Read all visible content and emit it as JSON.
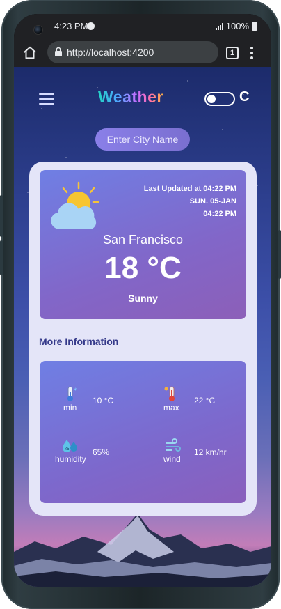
{
  "status_bar": {
    "time": "4:23 PM",
    "battery": "100%"
  },
  "browser": {
    "url": "http://localhost:4200",
    "tab_count": "1"
  },
  "app": {
    "title": "Weather",
    "unit_toggle_label": "C",
    "city_input_placeholder": "Enter City Name"
  },
  "current": {
    "last_updated": "Last Updated at 04:22 PM",
    "date": "SUN. 05-JAN",
    "time": "04:22 PM",
    "city": "San Francisco",
    "temperature": "18 °C",
    "condition": "Sunny",
    "icon": "sun-behind-cloud-icon"
  },
  "more_info": {
    "title": "More Information",
    "items": [
      {
        "label": "min",
        "value": "10 °C",
        "icon": "cold-thermometer-icon"
      },
      {
        "label": "max",
        "value": "22 °C",
        "icon": "hot-thermometer-icon"
      },
      {
        "label": "humidity",
        "value": "65%",
        "icon": "humidity-icon"
      },
      {
        "label": "wind",
        "value": "12 km/hr",
        "icon": "wind-icon"
      }
    ]
  },
  "colors": {
    "panel_start": "#6f7fe4",
    "panel_end": "#8c5fb8",
    "card_bg": "#e4e5f8",
    "section_title": "#353a8a"
  }
}
